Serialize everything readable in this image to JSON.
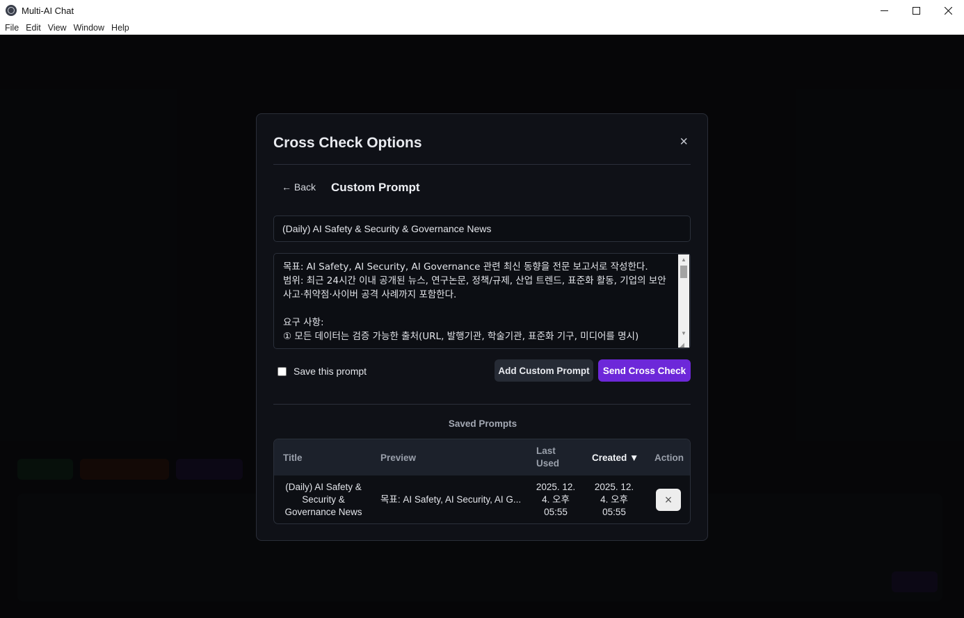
{
  "window": {
    "title": "Multi-AI Chat",
    "controls": {
      "minimize": "minimize-icon",
      "maximize": "maximize-icon",
      "close": "close-icon"
    }
  },
  "menu": [
    "File",
    "Edit",
    "View",
    "Window",
    "Help"
  ],
  "modal": {
    "title": "Cross Check Options",
    "close_label": "×",
    "back_label": "← Back",
    "subtitle": "Custom Prompt",
    "prompt_title_value": "(Daily) AI Safety & Security & Governance News",
    "prompt_body": "목표: AI Safety, AI Security, AI Governance 관련 최신 동향을 전문 보고서로 작성한다.\n범위: 최근 24시간 이내 공개된 뉴스, 연구논문, 정책/규제, 산업 트렌드, 표준화 활동, 기업의 보안사고·취약점·사이버 공격 사례까지 포함한다.\n\n요구 사항:\n① 모든 데이터는 검증 가능한 출처(URL, 발행기관, 학술기관, 표준화 기구, 미디어를 명시)",
    "save_checkbox_label": "Save this prompt",
    "save_checked": false,
    "add_button_label": "Add Custom Prompt",
    "send_button_label": "Send Cross Check",
    "saved_heading": "Saved Prompts",
    "table": {
      "headers": {
        "title": "Title",
        "preview": "Preview",
        "last_used_line1": "Last",
        "last_used_line2": "Used",
        "created": "Created ▼",
        "action": "Action"
      },
      "rows": [
        {
          "title_l1": "(Daily) AI Safety &",
          "title_l2": "Security &",
          "title_l3": "Governance News",
          "preview": "목표: AI Safety, AI Security, AI G...",
          "last_used_l1": "2025. 12.",
          "last_used_l2": "4. 오후",
          "last_used_l3": "05:55",
          "created_l1": "2025. 12.",
          "created_l2": "4. 오후",
          "created_l3": "05:55",
          "action_label": "×"
        }
      ]
    }
  },
  "colors": {
    "accent": "#6d28d9",
    "modal_bg": "#0f1117",
    "secondary_button": "#262b35"
  }
}
